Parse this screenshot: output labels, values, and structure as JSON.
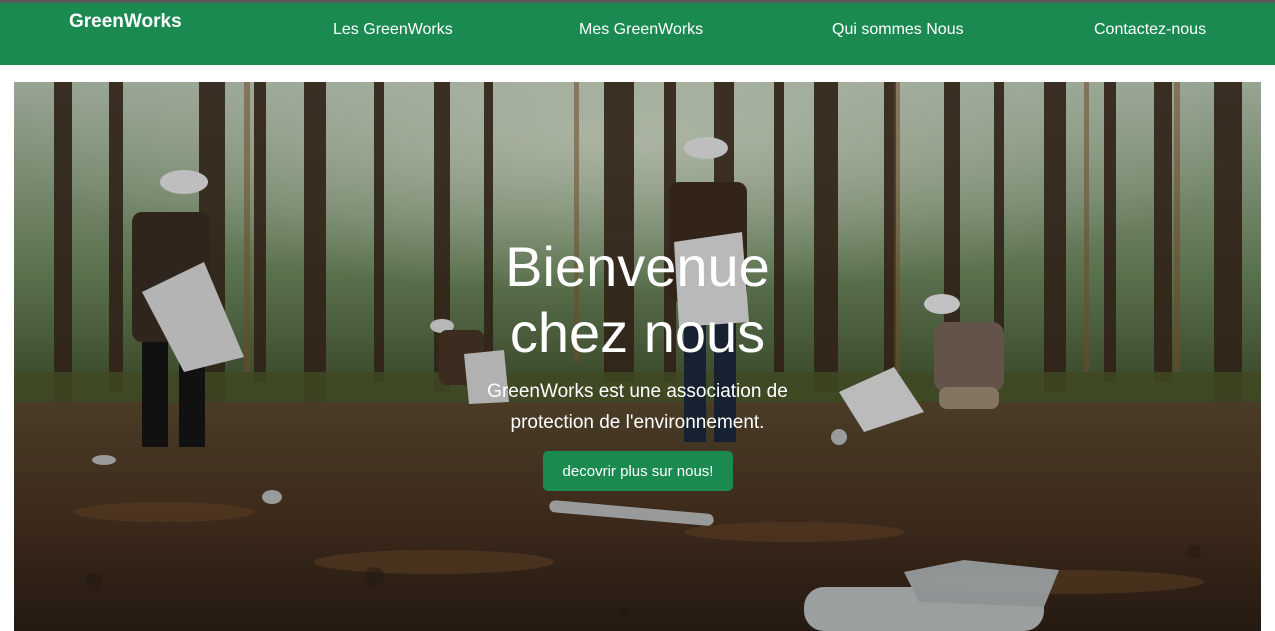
{
  "navbar": {
    "brand": "GreenWorks",
    "links": [
      "Les GreenWorks",
      "Mes GreenWorks",
      "Qui sommes Nous",
      "Contactez-nous"
    ],
    "bg_color": "#1b8a51"
  },
  "hero": {
    "title_line1": "Bienvenue",
    "title_line2": "chez nous",
    "subtitle_line1": "GreenWorks est une association de",
    "subtitle_line2": "protection de l'environnement.",
    "button_label": "decovrir plus sur nous!",
    "button_color": "#1b8a51",
    "image": "forest-cleanup-volunteers-photo"
  }
}
